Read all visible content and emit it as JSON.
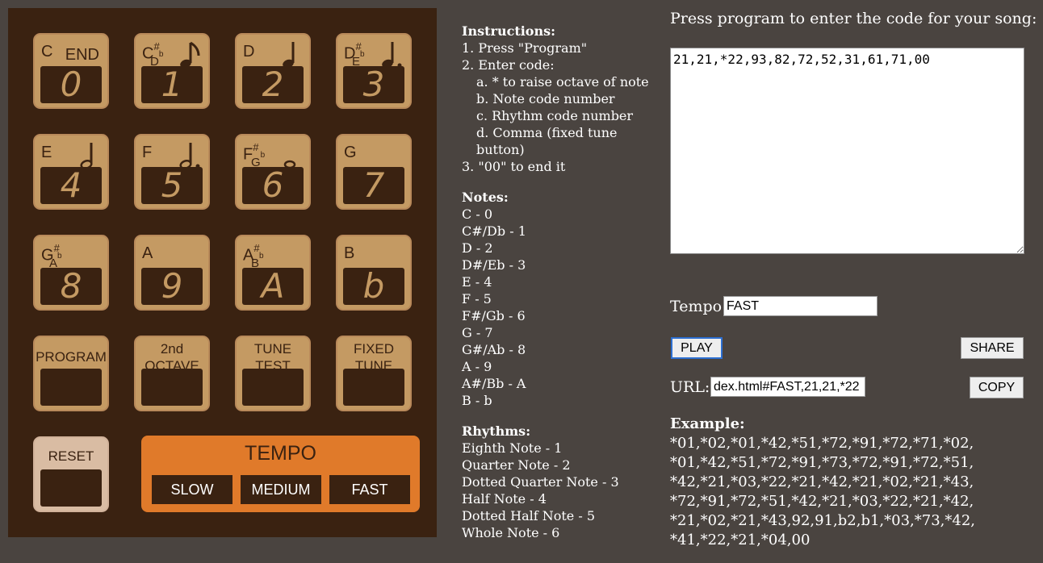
{
  "keypad": {
    "keys": [
      {
        "note": "C",
        "rhythm": "END",
        "digit": "0"
      },
      {
        "note": "C",
        "sharp": "#",
        "flat": "D",
        "flatmark": "b",
        "digit": "1",
        "rhythm_icon": "eighth-note-icon"
      },
      {
        "note": "D",
        "digit": "2",
        "rhythm_icon": "quarter-note-icon"
      },
      {
        "note": "D",
        "sharp": "#",
        "flat": "E",
        "flatmark": "b",
        "digit": "3",
        "rhythm_icon": "dotted-quarter-note-icon"
      },
      {
        "note": "E",
        "digit": "4",
        "rhythm_icon": "half-note-icon"
      },
      {
        "note": "F",
        "digit": "5",
        "rhythm_icon": "dotted-half-note-icon"
      },
      {
        "note": "F",
        "sharp": "#",
        "flat": "G",
        "flatmark": "b",
        "digit": "6",
        "rhythm_icon": "whole-note-icon"
      },
      {
        "note": "G",
        "digit": "7"
      },
      {
        "note": "G",
        "sharp": "#",
        "flat": "A",
        "flatmark": "b",
        "digit": "8"
      },
      {
        "note": "A",
        "digit": "9"
      },
      {
        "note": "A",
        "sharp": "#",
        "flat": "B",
        "flatmark": "b",
        "digit": "A"
      },
      {
        "note": "B",
        "digit": "b"
      }
    ],
    "functions": {
      "program": "PROGRAM",
      "octave_1": "2nd",
      "octave_2": "OCTAVE",
      "tune_test_1": "TUNE",
      "tune_test_2": "TEST",
      "fixed_tune_1": "FIXED",
      "fixed_tune_2": "TUNE",
      "reset": "RESET"
    },
    "tempo": {
      "title": "TEMPO",
      "slow": "SLOW",
      "medium": "MEDIUM",
      "fast": "FAST"
    }
  },
  "instructions": {
    "title": "Instructions:",
    "steps": [
      "1. Press \"Program\"",
      "2. Enter code:",
      "a. * to raise octave of note",
      "b. Note code number",
      "c. Rhythm code number",
      "d. Comma (fixed tune button)",
      "3. \"00\" to end it"
    ],
    "notes_title": "Notes:",
    "notes": [
      "C - 0",
      "C#/Db - 1",
      "D - 2",
      "D#/Eb - 3",
      "E - 4",
      "F - 5",
      "F#/Gb - 6",
      "G - 7",
      "G#/Ab - 8",
      "A - 9",
      "A#/Bb - A",
      "B - b"
    ],
    "rhythms_title": "Rhythms:",
    "rhythms": [
      "Eighth Note - 1",
      "Quarter Note - 2",
      "Dotted Quarter Note - 3",
      "Half Note - 4",
      "Dotted Half Note - 5",
      "Whole Note - 6"
    ]
  },
  "editor": {
    "prompt": "Press program to enter the code for your song:",
    "code": "21,21,*22,93,82,72,52,31,61,71,00",
    "tempo_label": "Tempo:",
    "tempo_value": "FAST",
    "play": "PLAY",
    "share": "SHARE",
    "url_label": "URL:",
    "url_value": "dex.html#FAST,21,21,*22",
    "copy": "COPY",
    "example_title": "Example:",
    "example_lines": [
      "*01,*02,*01,*42,*51,*72,*91,*72,*71,*02,",
      "*01,*42,*51,*72,*91,*73,*72,*91,*72,*51,",
      "*42,*21,*03,*22,*21,*42,*21,*02,*21,*43,",
      "*72,*91,*72,*51,*42,*21,*03,*22,*21,*42,",
      "*21,*02,*21,*43,92,91,b2,b1,*03,*73,*42,",
      "*41,*22,*21,*04,00"
    ]
  },
  "colors": {
    "panel": "#3a2211",
    "key": "#c49a63",
    "tempo": "#e07a2a",
    "reset": "#d9bca3",
    "background": "#4a4440"
  }
}
